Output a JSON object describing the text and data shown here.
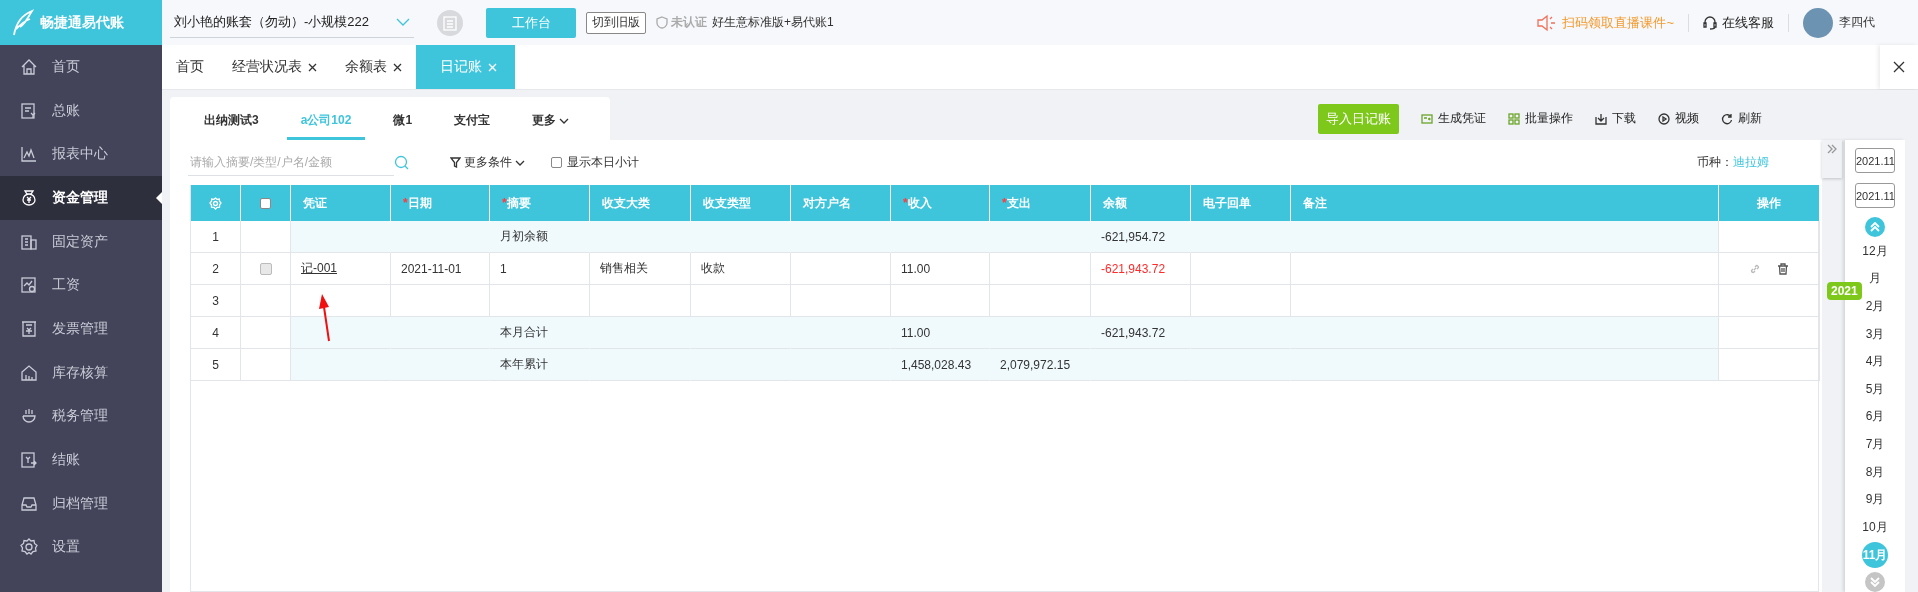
{
  "app": {
    "logo": "畅捷通易代账"
  },
  "topbar": {
    "account": "刘小艳的账套（勿动）-小规模222",
    "workbench": "工作台",
    "old_version": "切到旧版",
    "certification": "未认证",
    "edition": "好生意标准版+易代账1",
    "promo": "扫码领取直播课件~",
    "support": "在线客服",
    "user": "李四代"
  },
  "sidebar": {
    "items": [
      {
        "label": "首页",
        "selected": false
      },
      {
        "label": "总账",
        "selected": false
      },
      {
        "label": "报表中心",
        "selected": false
      },
      {
        "label": "资金管理",
        "selected": true
      },
      {
        "label": "固定资产",
        "selected": false
      },
      {
        "label": "工资",
        "selected": false
      },
      {
        "label": "发票管理",
        "selected": false
      },
      {
        "label": "库存核算",
        "selected": false
      },
      {
        "label": "税务管理",
        "selected": false
      },
      {
        "label": "结账",
        "selected": false
      },
      {
        "label": "归档管理",
        "selected": false
      },
      {
        "label": "设置",
        "selected": false
      }
    ]
  },
  "page_tabs": [
    {
      "label": "首页",
      "closable": false,
      "selected": false
    },
    {
      "label": "经营状况表",
      "closable": true,
      "selected": false
    },
    {
      "label": "余额表",
      "closable": true,
      "selected": false
    },
    {
      "label": "日记账",
      "closable": true,
      "selected": true
    }
  ],
  "account_tabs": [
    {
      "label": "出纳测试3",
      "kind": "tab",
      "selected": false
    },
    {
      "label": "a公司102",
      "kind": "tab",
      "selected": true
    },
    {
      "label": "微1",
      "kind": "tab",
      "selected": false
    },
    {
      "label": "支付宝",
      "kind": "tab",
      "selected": false
    },
    {
      "label": "更多",
      "kind": "dropdown",
      "selected": false
    }
  ],
  "toolbar": [
    {
      "label": "导入日记账",
      "kind": "primary"
    },
    {
      "label": "生成凭证",
      "kind": "voucher"
    },
    {
      "label": "批量操作",
      "kind": "batch"
    },
    {
      "label": "下载",
      "kind": "download"
    },
    {
      "label": "视频",
      "kind": "video"
    },
    {
      "label": "刷新",
      "kind": "refresh"
    }
  ],
  "search": {
    "placeholder": "请输入摘要/类型/户名/金额"
  },
  "filter": {
    "label": "更多条件"
  },
  "daily_subtotal": {
    "label": "显示本日小计",
    "checked": false
  },
  "currency": {
    "label": "币种：",
    "value": "迪拉姆"
  },
  "table": {
    "select_all": {
      "checked": false
    },
    "columns": [
      {
        "label": "凭证"
      },
      {
        "label": "日期",
        "required_mark": "*"
      },
      {
        "label": "摘要",
        "required_mark": "*"
      },
      {
        "label": "收支大类"
      },
      {
        "label": "收支类型"
      },
      {
        "label": "对方户名"
      },
      {
        "label": "收入",
        "required_mark": "*"
      },
      {
        "label": "支出",
        "required_mark": "*"
      },
      {
        "label": "余额"
      },
      {
        "label": "电子回单"
      },
      {
        "label": "备注"
      },
      {
        "label": "操作"
      }
    ],
    "rows": [
      {
        "number": "1",
        "kind": "summary",
        "label": "月初余额",
        "balance": "-621,954.72"
      },
      {
        "number": "2",
        "kind": "entry",
        "checked": false,
        "voucher": "记-001",
        "date": "2021-11-01",
        "summary": "1",
        "category": "销售相关",
        "type": "收款",
        "income": "11.00",
        "balance": "-621,943.72",
        "balance_alert": true
      },
      {
        "number": "3",
        "kind": "blank"
      },
      {
        "number": "4",
        "kind": "summary",
        "label": "本月合计",
        "income": "11.00",
        "balance": "-621,943.72"
      },
      {
        "number": "5",
        "kind": "summary",
        "label": "本年累计",
        "income": "1,458,028.43",
        "expense": "2,079,972.15"
      }
    ]
  },
  "timeline": {
    "dates": [
      "2021.11",
      "2021.11"
    ],
    "year": "2021",
    "months": [
      {
        "label": "12月",
        "selected": false
      },
      {
        "label": "月",
        "selected": false
      },
      {
        "label": "2月",
        "selected": false
      },
      {
        "label": "3月",
        "selected": false
      },
      {
        "label": "4月",
        "selected": false
      },
      {
        "label": "5月",
        "selected": false
      },
      {
        "label": "6月",
        "selected": false
      },
      {
        "label": "7月",
        "selected": false
      },
      {
        "label": "8月",
        "selected": false
      },
      {
        "label": "9月",
        "selected": false
      },
      {
        "label": "10月",
        "selected": false
      },
      {
        "label": "11月",
        "selected": true
      }
    ]
  }
}
